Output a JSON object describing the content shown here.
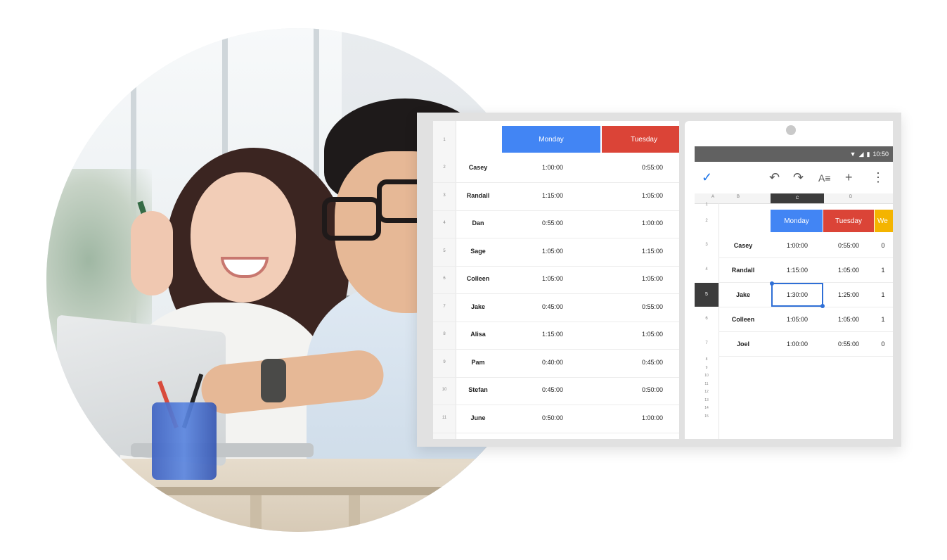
{
  "colors": {
    "monday": "#4285f4",
    "tuesday": "#db4437",
    "wednesday": "#f4b400",
    "statusbar": "#616161",
    "accent": "#1a73e8"
  },
  "sheet": {
    "headers": [
      "Monday",
      "Tuesday"
    ],
    "rows": [
      {
        "num": "2",
        "name": "Casey",
        "mon": "1:00:00",
        "tue": "0:55:00"
      },
      {
        "num": "3",
        "name": "Randall",
        "mon": "1:15:00",
        "tue": "1:05:00"
      },
      {
        "num": "4",
        "name": "Dan",
        "mon": "0:55:00",
        "tue": "1:00:00"
      },
      {
        "num": "5",
        "name": "Sage",
        "mon": "1:05:00",
        "tue": "1:15:00"
      },
      {
        "num": "6",
        "name": "Colleen",
        "mon": "1:05:00",
        "tue": "1:05:00"
      },
      {
        "num": "7",
        "name": "Jake",
        "mon": "0:45:00",
        "tue": "0:55:00"
      },
      {
        "num": "8",
        "name": "Alisa",
        "mon": "1:15:00",
        "tue": "1:05:00"
      },
      {
        "num": "9",
        "name": "Pam",
        "mon": "0:40:00",
        "tue": "0:45:00"
      },
      {
        "num": "10",
        "name": "Stefan",
        "mon": "0:45:00",
        "tue": "0:50:00"
      },
      {
        "num": "11",
        "name": "June",
        "mon": "0:50:00",
        "tue": "1:00:00"
      }
    ],
    "first_row_num": "1"
  },
  "phone": {
    "time": "10:50",
    "toolbar": {
      "check": "✓",
      "undo": "↶",
      "redo": "↷",
      "format": "A≡",
      "add": "+",
      "more": "⋮"
    },
    "col_letters": [
      "A",
      "B",
      "C",
      "D"
    ],
    "headers": [
      "Monday",
      "Tuesday",
      "We"
    ],
    "row_header_num": "2",
    "rows": [
      {
        "num": "3",
        "name": "Casey",
        "mon": "1:00:00",
        "tue": "0:55:00",
        "wed": "0"
      },
      {
        "num": "4",
        "name": "Randall",
        "mon": "1:15:00",
        "tue": "1:05:00",
        "wed": "1"
      },
      {
        "num": "5",
        "name": "Jake",
        "mon": "1:30:00",
        "tue": "1:25:00",
        "wed": "1"
      },
      {
        "num": "6",
        "name": "Colleen",
        "mon": "1:05:00",
        "tue": "1:05:00",
        "wed": "1"
      },
      {
        "num": "7",
        "name": "Joel",
        "mon": "1:00:00",
        "tue": "0:55:00",
        "wed": "0"
      }
    ],
    "extra_row_nums": [
      "8",
      "9",
      "10",
      "11",
      "12",
      "13",
      "14",
      "15"
    ],
    "top_row_num": "1"
  }
}
